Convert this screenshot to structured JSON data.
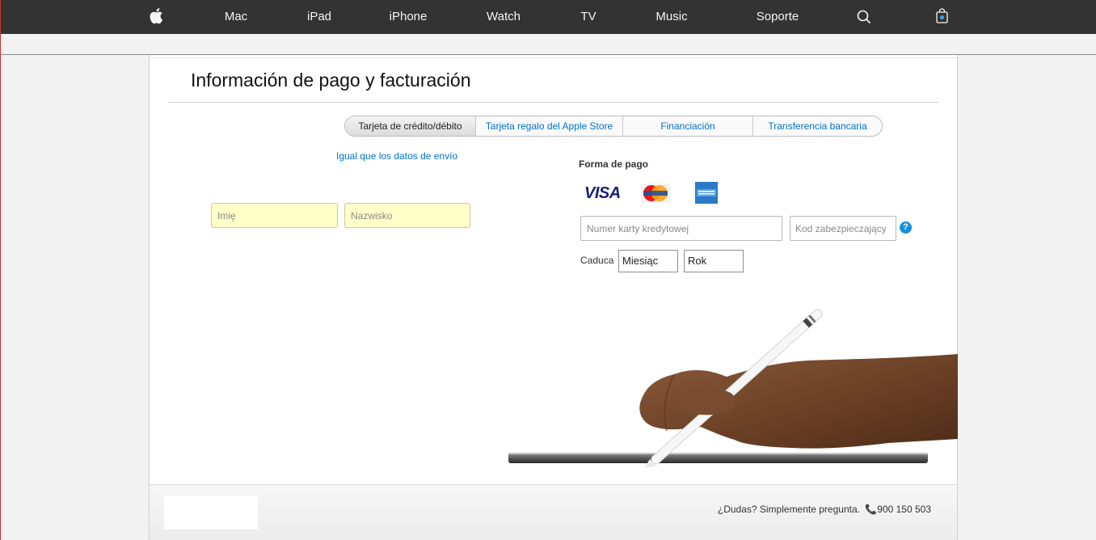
{
  "nav": {
    "items": [
      "Mac",
      "iPad",
      "iPhone",
      "Watch",
      "TV",
      "Music",
      "Soporte"
    ],
    "icons": [
      "apple-logo-icon",
      "search-icon",
      "shopping-bag-icon"
    ]
  },
  "page": {
    "title": "Información de pago y facturación"
  },
  "tabs": [
    {
      "label": "Tarjeta de crédito/débito",
      "active": true
    },
    {
      "label": "Tarjeta regalo del Apple Store",
      "active": false
    },
    {
      "label": "Financiación",
      "active": false
    },
    {
      "label": "Transferencia bancaria",
      "active": false
    }
  ],
  "billing": {
    "same_as_shipping": "Igual que los datos de envío",
    "first_name_placeholder": "Imię",
    "last_name_placeholder": "Nazwisko"
  },
  "payment": {
    "label": "Forma de pago",
    "card_logos": [
      "visa-logo",
      "mastercard-logo",
      "amex-logo"
    ],
    "visa_text": "VISA",
    "card_number_placeholder": "Numer karty kredytowej",
    "security_code_placeholder": "Kod zabezpieczający",
    "help_glyph": "?",
    "expiry_label": "Caduca",
    "month_value": "Miesiąc",
    "year_value": "Rok"
  },
  "footer": {
    "help_text": "¿Dudas? Simplemente pregunta.",
    "phone": "900 150 503"
  },
  "colors": {
    "nav_bg": "#333333",
    "link": "#0070c9",
    "highlight_input": "#ffffc8"
  }
}
